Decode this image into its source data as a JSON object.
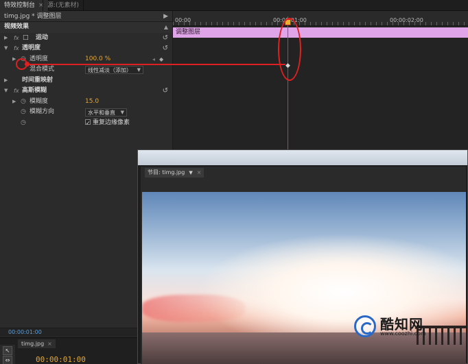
{
  "tabs": [
    {
      "label": "特效控制台",
      "active": true
    },
    {
      "label": "源:(无素材)",
      "active": false
    }
  ],
  "effect_controls": {
    "clip_title": "timg.jpg * 调整图层",
    "section_video_effects": "视频效果",
    "motion_label": "运动",
    "opacity_label": "透明度",
    "opacity_param": {
      "name": "透明度",
      "value": "100.0 %"
    },
    "blend_mode": {
      "name": "混合模式",
      "value": "线性减淡（添加）"
    },
    "time_remap_label": "时间重映射",
    "gaussian_blur_label": "高斯模糊",
    "blurriness": {
      "name": "模糊度",
      "value": "15.0"
    },
    "blur_dimensions": {
      "name": "模糊方向",
      "value": "水平和垂直"
    },
    "repeat_edge_label": "重复边缘像素",
    "current_time": "00:00:01:00"
  },
  "timeline": {
    "ruler_labels": [
      "00:00",
      "00:00:01:00",
      "00:00:02:00"
    ],
    "layer_name": "调整图层"
  },
  "sequence": {
    "tab_label": "timg.jpg",
    "timecode": "00:00:01:00"
  },
  "program_monitor": {
    "tab_label": "节目: timg.jpg"
  },
  "watermark": {
    "brand": "酷知网",
    "url": "www.coozhi.com"
  },
  "colors": {
    "accent_value": "#e8a830",
    "layer_bar": "#e0a4e8",
    "annotation": "#e02020"
  }
}
